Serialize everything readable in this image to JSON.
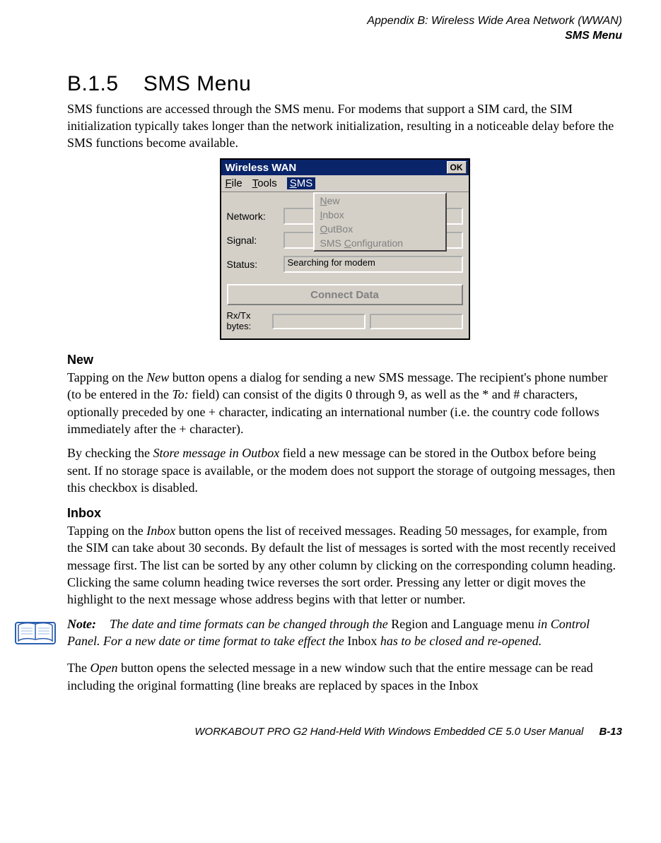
{
  "header": {
    "line1": "Appendix  B:  Wireless Wide Area Network (WWAN)",
    "line2": "SMS Menu"
  },
  "section": {
    "number": "B.1.5",
    "title": "SMS  Menu"
  },
  "intro": "SMS functions are accessed through the SMS menu. For modems that support a SIM card, the SIM initialization typically takes longer than the network initialization, resulting in a noticeable delay before the SMS functions become available.",
  "window": {
    "title": "Wireless WAN",
    "ok": "OK",
    "menus": {
      "file": "File",
      "tools": "Tools",
      "sms": "SMS"
    },
    "dropdown": {
      "new": "New",
      "inbox": "Inbox",
      "outbox": "OutBox",
      "config": "SMS Configuration"
    },
    "labels": {
      "network": "Network:",
      "signal": "Signal:",
      "status": "Status:"
    },
    "status_value": "Searching for modem",
    "connect": "Connect Data",
    "rxtx": "Rx/Tx bytes:"
  },
  "new_heading": "New",
  "new_p1_a": "Tapping on the ",
  "new_p1_b": "New",
  "new_p1_c": " button opens a dialog for sending a new SMS message. The recipient's phone number (to be entered in the ",
  "new_p1_d": "To:",
  "new_p1_e": " field) can consist of the digits 0 through 9, as well as the * and # characters, optionally preceded by one + character, indicating an international number (i.e. the country code follows immediately after the + character).",
  "new_p2_a": "By checking the ",
  "new_p2_b": "Store message in Outbox",
  "new_p2_c": " field a new message can be stored in the Outbox before being sent. If no storage space is available, or the modem does not support the storage of outgoing messages, then this checkbox is disabled.",
  "inbox_heading": "Inbox",
  "inbox_p1_a": "Tapping on the ",
  "inbox_p1_b": "Inbox",
  "inbox_p1_c": " button opens the list of received messages. Reading 50 messages, for example, from the SIM can take about 30 seconds. By default the list of messages is sorted with the most recently received message first. The list can be sorted by any other column by clicking on the corresponding column heading. Clicking the same column heading twice reverses the sort order. Pressing any letter or digit moves the highlight to the next message whose address begins with that letter or number.",
  "note": {
    "label": "Note:",
    "t1": "The date and time formats can be changed through the ",
    "r1": "Region and Language menu",
    "t2": " in Control Panel. For a new date or time format to take effect the ",
    "r2": "Inbox",
    "t3": " has to be closed and re-opened."
  },
  "open_p_a": "The ",
  "open_p_b": "Open",
  "open_p_c": " button opens the selected message in a new window such that the entire message can be read including the original formatting (line breaks are replaced by spaces in the Inbox",
  "footer": {
    "text": "WORKABOUT PRO G2 Hand-Held With Windows Embedded CE 5.0 User Manual",
    "page": "B-13"
  }
}
